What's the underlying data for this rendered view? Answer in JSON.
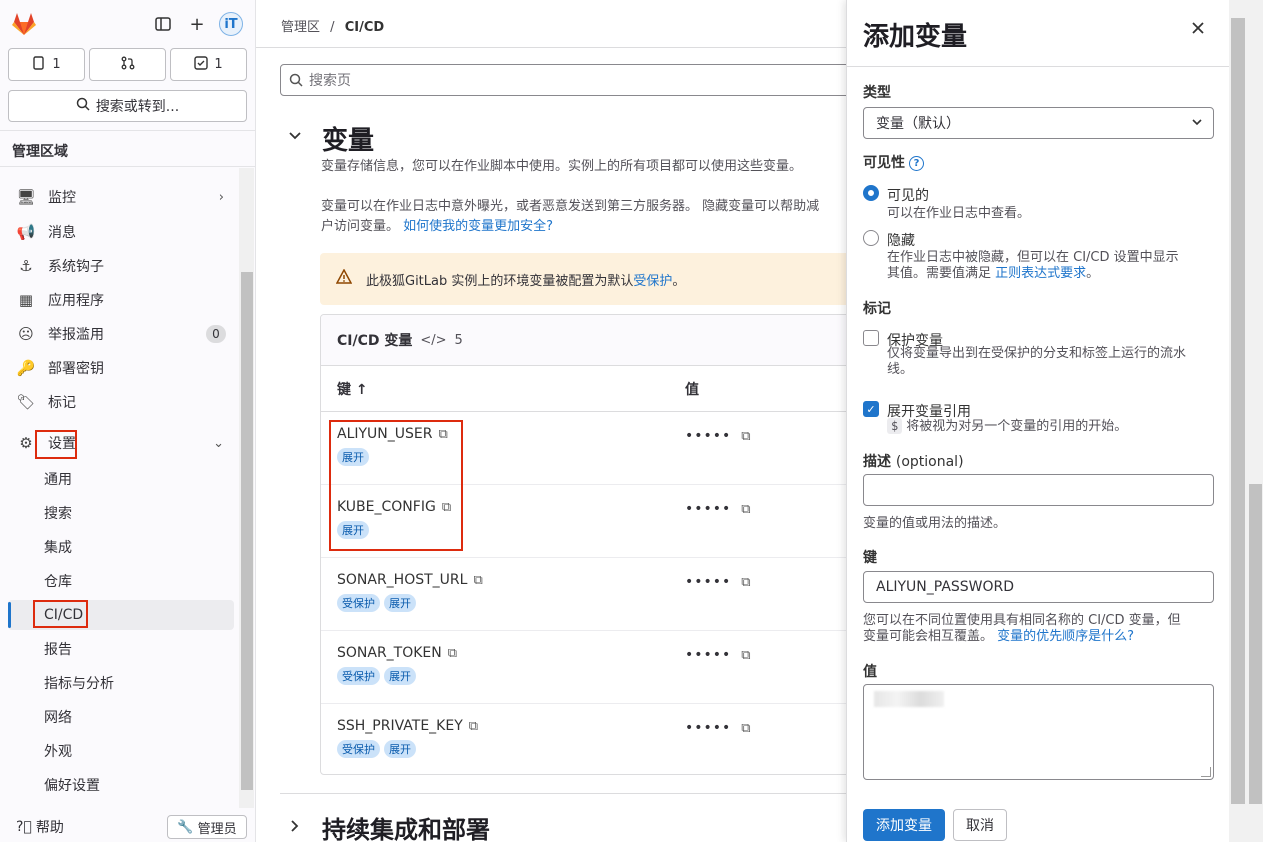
{
  "sidebar": {
    "counters": {
      "issues": "1",
      "mrs": "",
      "todos": "1"
    },
    "search_label": "搜索或转到...",
    "section_title": "管理区域",
    "items": [
      {
        "label": "监控"
      },
      {
        "label": "消息"
      },
      {
        "label": "系统钩子"
      },
      {
        "label": "应用程序"
      },
      {
        "label": "举报滥用",
        "count": "0"
      },
      {
        "label": "部署密钥"
      },
      {
        "label": "标记"
      },
      {
        "label": "设置"
      }
    ],
    "subitems": [
      "通用",
      "搜索",
      "集成",
      "仓库",
      "CI/CD",
      "报告",
      "指标与分析",
      "网络",
      "外观",
      "偏好设置"
    ],
    "help_label": "帮助",
    "admin_label": "管理员"
  },
  "breadcrumb": {
    "root": "管理区",
    "current": "CI/CD"
  },
  "main": {
    "search_placeholder": "搜索页",
    "section_title": "变量",
    "desc1": "变量存储信息，您可以在作业脚本中使用。实例上的所有项目都可以使用这些变量。",
    "desc2": "变量可以在作业日志中意外曝光，或者恶意发送到第三方服务器。 隐藏变量可以帮助减",
    "desc3": "户访问变量。",
    "desc_link": "如何使我的变量更加安全?",
    "alert_text": "此极狐GitLab 实例上的环境变量被配置为默认",
    "alert_link": "受保护",
    "alert_end": "。",
    "card_title": "CI/CD 变量",
    "card_count": "5",
    "col_key": "键 ↑",
    "col_value": "值",
    "masked": "•••••",
    "rows": [
      {
        "key": "ALIYUN_USER",
        "b1": "展开",
        "b2": ""
      },
      {
        "key": "KUBE_CONFIG",
        "b1": "展开",
        "b2": ""
      },
      {
        "key": "SONAR_HOST_URL",
        "b1": "受保护",
        "b2": "展开"
      },
      {
        "key": "SONAR_TOKEN",
        "b1": "受保护",
        "b2": "展开"
      },
      {
        "key": "SSH_PRIVATE_KEY",
        "b1": "受保护",
        "b2": "展开"
      }
    ],
    "next_section": "持续集成和部署"
  },
  "drawer": {
    "title": "添加变量",
    "type_label": "类型",
    "type_value": "变量（默认）",
    "visibility_label": "可见性",
    "vis_visible": "可见的",
    "vis_visible_help": "可以在作业日志中查看。",
    "vis_masked": "隐藏",
    "vis_masked_help1": "在作业日志中被隐藏，但可以在 CI/CD 设置中显示",
    "vis_masked_help2": "其值。需要值满足 ",
    "vis_masked_link": "正则表达式要求",
    "vis_masked_end": "。",
    "flags_label": "标记",
    "protect_label": "保护变量",
    "protect_help1": "仅将变量导出到在受保护的分支和标签上运行的流水",
    "protect_help2": "线。",
    "expand_label": "展开变量引用",
    "expand_help": "将被视为对另一个变量的引用的开始。",
    "dollar": "$",
    "desc_label": "描述",
    "desc_optional": "(optional)",
    "desc_help": "变量的值或用法的描述。",
    "key_label": "键",
    "key_value": "ALIYUN_PASSWORD",
    "key_help1": "您可以在不同位置使用具有相同名称的 CI/CD 变量，但",
    "key_help2": "变量可能会相互覆盖。 ",
    "key_link": "变量的优先顺序是什么?",
    "value_label": "值",
    "submit": "添加变量",
    "cancel": "取消"
  }
}
